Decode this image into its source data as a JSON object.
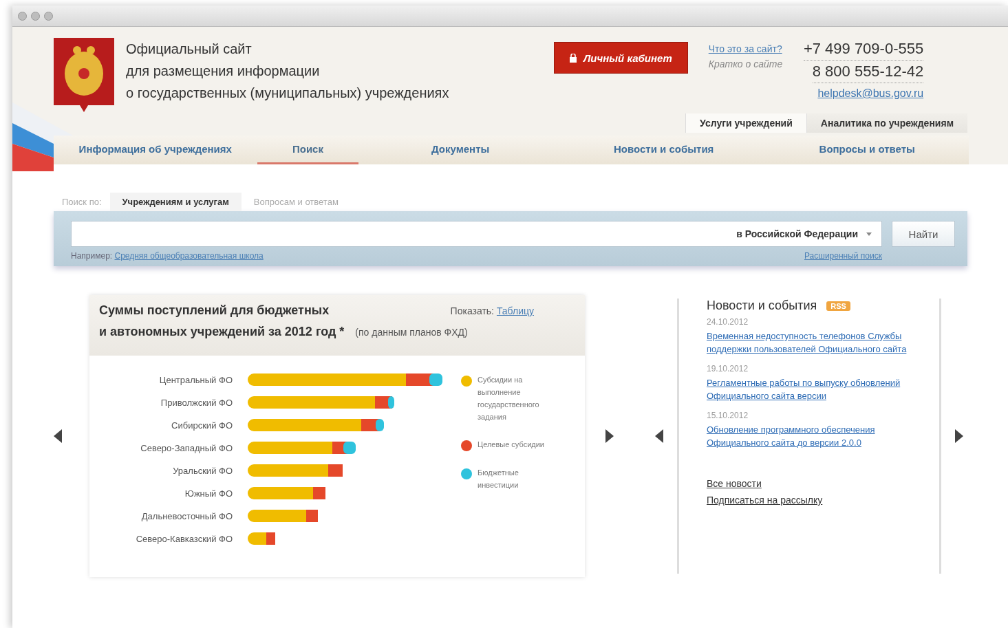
{
  "header": {
    "title_lines": [
      "Официальный сайт",
      "для размещения информации",
      "о государственных (муниципальных) учреждениях"
    ],
    "cabinet_button": "Личный кабинет",
    "about_link": "Что это за сайт?",
    "about_note": "Кратко о сайте",
    "phones": [
      "+7 499 709-0-555",
      "8 800 555-12-42"
    ],
    "email": "helpdesk@bus.gov.ru"
  },
  "top_tabs": [
    {
      "label": "Услуги учреждений",
      "selected": true
    },
    {
      "label": "Аналитика по учреждениям",
      "selected": false
    }
  ],
  "nav": [
    {
      "label": "Информация об учреждениях",
      "selected": false
    },
    {
      "label": "Поиск",
      "selected": true
    },
    {
      "label": "Документы",
      "selected": false
    },
    {
      "label": "Новости и события",
      "selected": false
    },
    {
      "label": "Вопросы и ответы",
      "selected": false
    }
  ],
  "search": {
    "scope_label": "Поиск по:",
    "scopes": [
      {
        "label": "Учреждениям и услугам",
        "selected": true
      },
      {
        "label": "Вопросам и ответам",
        "selected": false
      }
    ],
    "region": "в Российской Федерации",
    "button": "Найти",
    "example_label": "Например:",
    "example_link": "Средняя общеобразовательная школа",
    "advanced_link": "Расширенный поиск"
  },
  "chart_panel": {
    "title_line1": "Суммы поступлений для бюджетных",
    "title_line2": "и автономных учреждений за 2012 год *",
    "source_note": "(по данным планов ФХД)",
    "show_label": "Показать:",
    "show_link": "Таблицу",
    "categories": [
      "Центральный ФО",
      "Приволжский ФО",
      "Сибирский ФО",
      "Северо-Западный ФО",
      "Уральский ФО",
      "Южный ФО",
      "Дальневосточный ФО",
      "Северо-Кавказский ФО"
    ],
    "legend": [
      {
        "label": "Субсидии на выполнение государственного задания",
        "color": "#f0bc00"
      },
      {
        "label": "Целевые субсидии",
        "color": "#e5482a"
      },
      {
        "label": "Бюджетные инвестиции",
        "color": "#2fc3dd"
      }
    ]
  },
  "news": {
    "title": "Новости и события",
    "badge": "RSS",
    "items": [
      {
        "date": "24.10.2012",
        "text": "Временная недоступность телефонов Службы поддержки пользователей Официального сайта"
      },
      {
        "date": "19.10.2012",
        "text": "Регламентные работы по выпуску обновлений Официального сайта версии"
      },
      {
        "date": "15.10.2012",
        "text": "Обновление программного обеспечения Официального сайта до версии 2.0.0"
      }
    ],
    "links": [
      "Все новости",
      "Подписаться на рассылку"
    ]
  }
}
